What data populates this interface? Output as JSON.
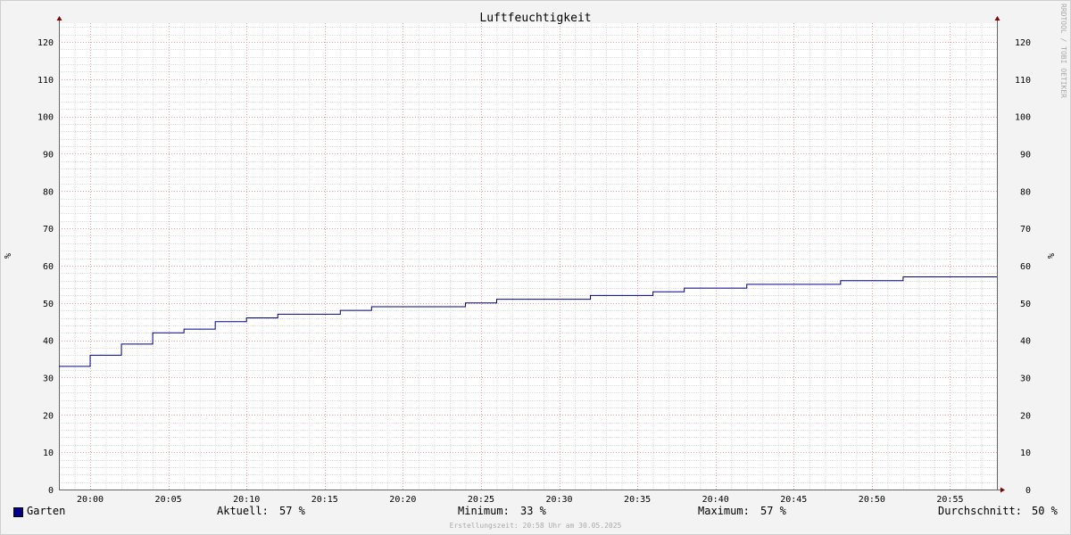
{
  "chart_data": {
    "type": "line",
    "title": "Luftfeuchtigkeit",
    "ylabel_left": "%",
    "ylabel_right": "%",
    "ylim": [
      0,
      125
    ],
    "yticks": [
      0,
      10,
      20,
      30,
      40,
      50,
      60,
      70,
      80,
      90,
      100,
      110,
      120
    ],
    "x_range": [
      "19:58",
      "20:58"
    ],
    "xticks": [
      "20:00",
      "20:05",
      "20:10",
      "20:15",
      "20:20",
      "20:25",
      "20:30",
      "20:35",
      "20:40",
      "20:45",
      "20:50",
      "20:55"
    ],
    "grid": true,
    "step": true,
    "series": [
      {
        "name": "Garten",
        "color": "#00008b",
        "x": [
          "19:58",
          "20:00",
          "20:02",
          "20:04",
          "20:06",
          "20:08",
          "20:10",
          "20:12",
          "20:16",
          "20:18",
          "20:24",
          "20:26",
          "20:32",
          "20:36",
          "20:38",
          "20:42",
          "20:48",
          "20:52",
          "20:58"
        ],
        "values": [
          33,
          36,
          39,
          42,
          43,
          45,
          46,
          47,
          48,
          49,
          50,
          51,
          52,
          53,
          54,
          55,
          56,
          57,
          57
        ]
      }
    ]
  },
  "legend": {
    "series_name": "Garten",
    "aktuell_label": "Aktuell:",
    "aktuell_value": "57 %",
    "minimum_label": "Minimum:",
    "minimum_value": "33 %",
    "maximum_label": "Maximum:",
    "maximum_value": "57 %",
    "avg_label": "Durchschnitt:",
    "avg_value": "50 %"
  },
  "footer": "Erstellungszeit: 20:58 Uhr am 30.05.2025",
  "watermark": "RRDTOOL / TOBI OETIKER"
}
